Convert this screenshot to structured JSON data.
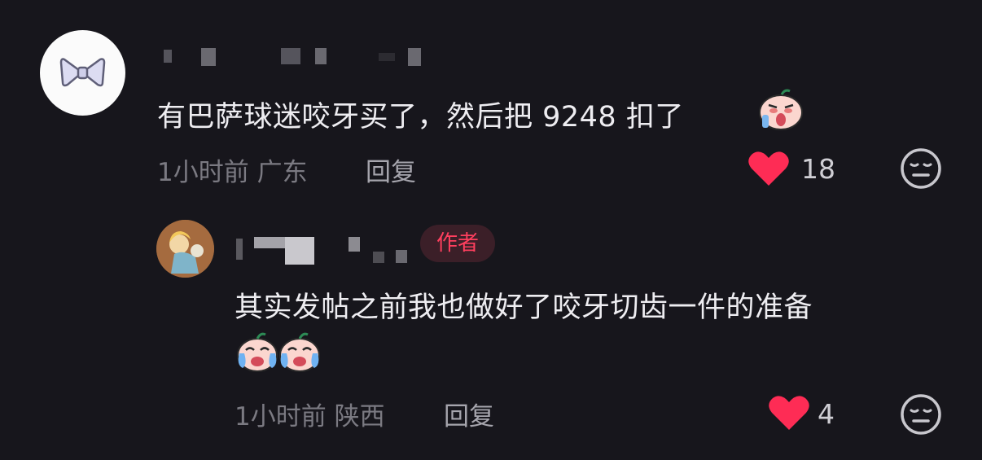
{
  "comments": [
    {
      "text": "有巴萨球迷咬牙买了，然后把 9248 扣了",
      "time_location": "1小时前 广东",
      "reply_label": "回复",
      "likes": "18",
      "emoji_icon": "crying-face-emoji"
    },
    {
      "author_tag": "作者",
      "text": "其实发帖之前我也做好了咬牙切齿一件的准备",
      "time_location": "1小时前 陕西",
      "reply_label": "回复",
      "likes": "4",
      "emoji_icon": "tearful-laugh-emoji"
    }
  ],
  "colors": {
    "background": "#17161c",
    "heart": "#fe2c55",
    "author_tag_text": "#fe3f5e"
  }
}
